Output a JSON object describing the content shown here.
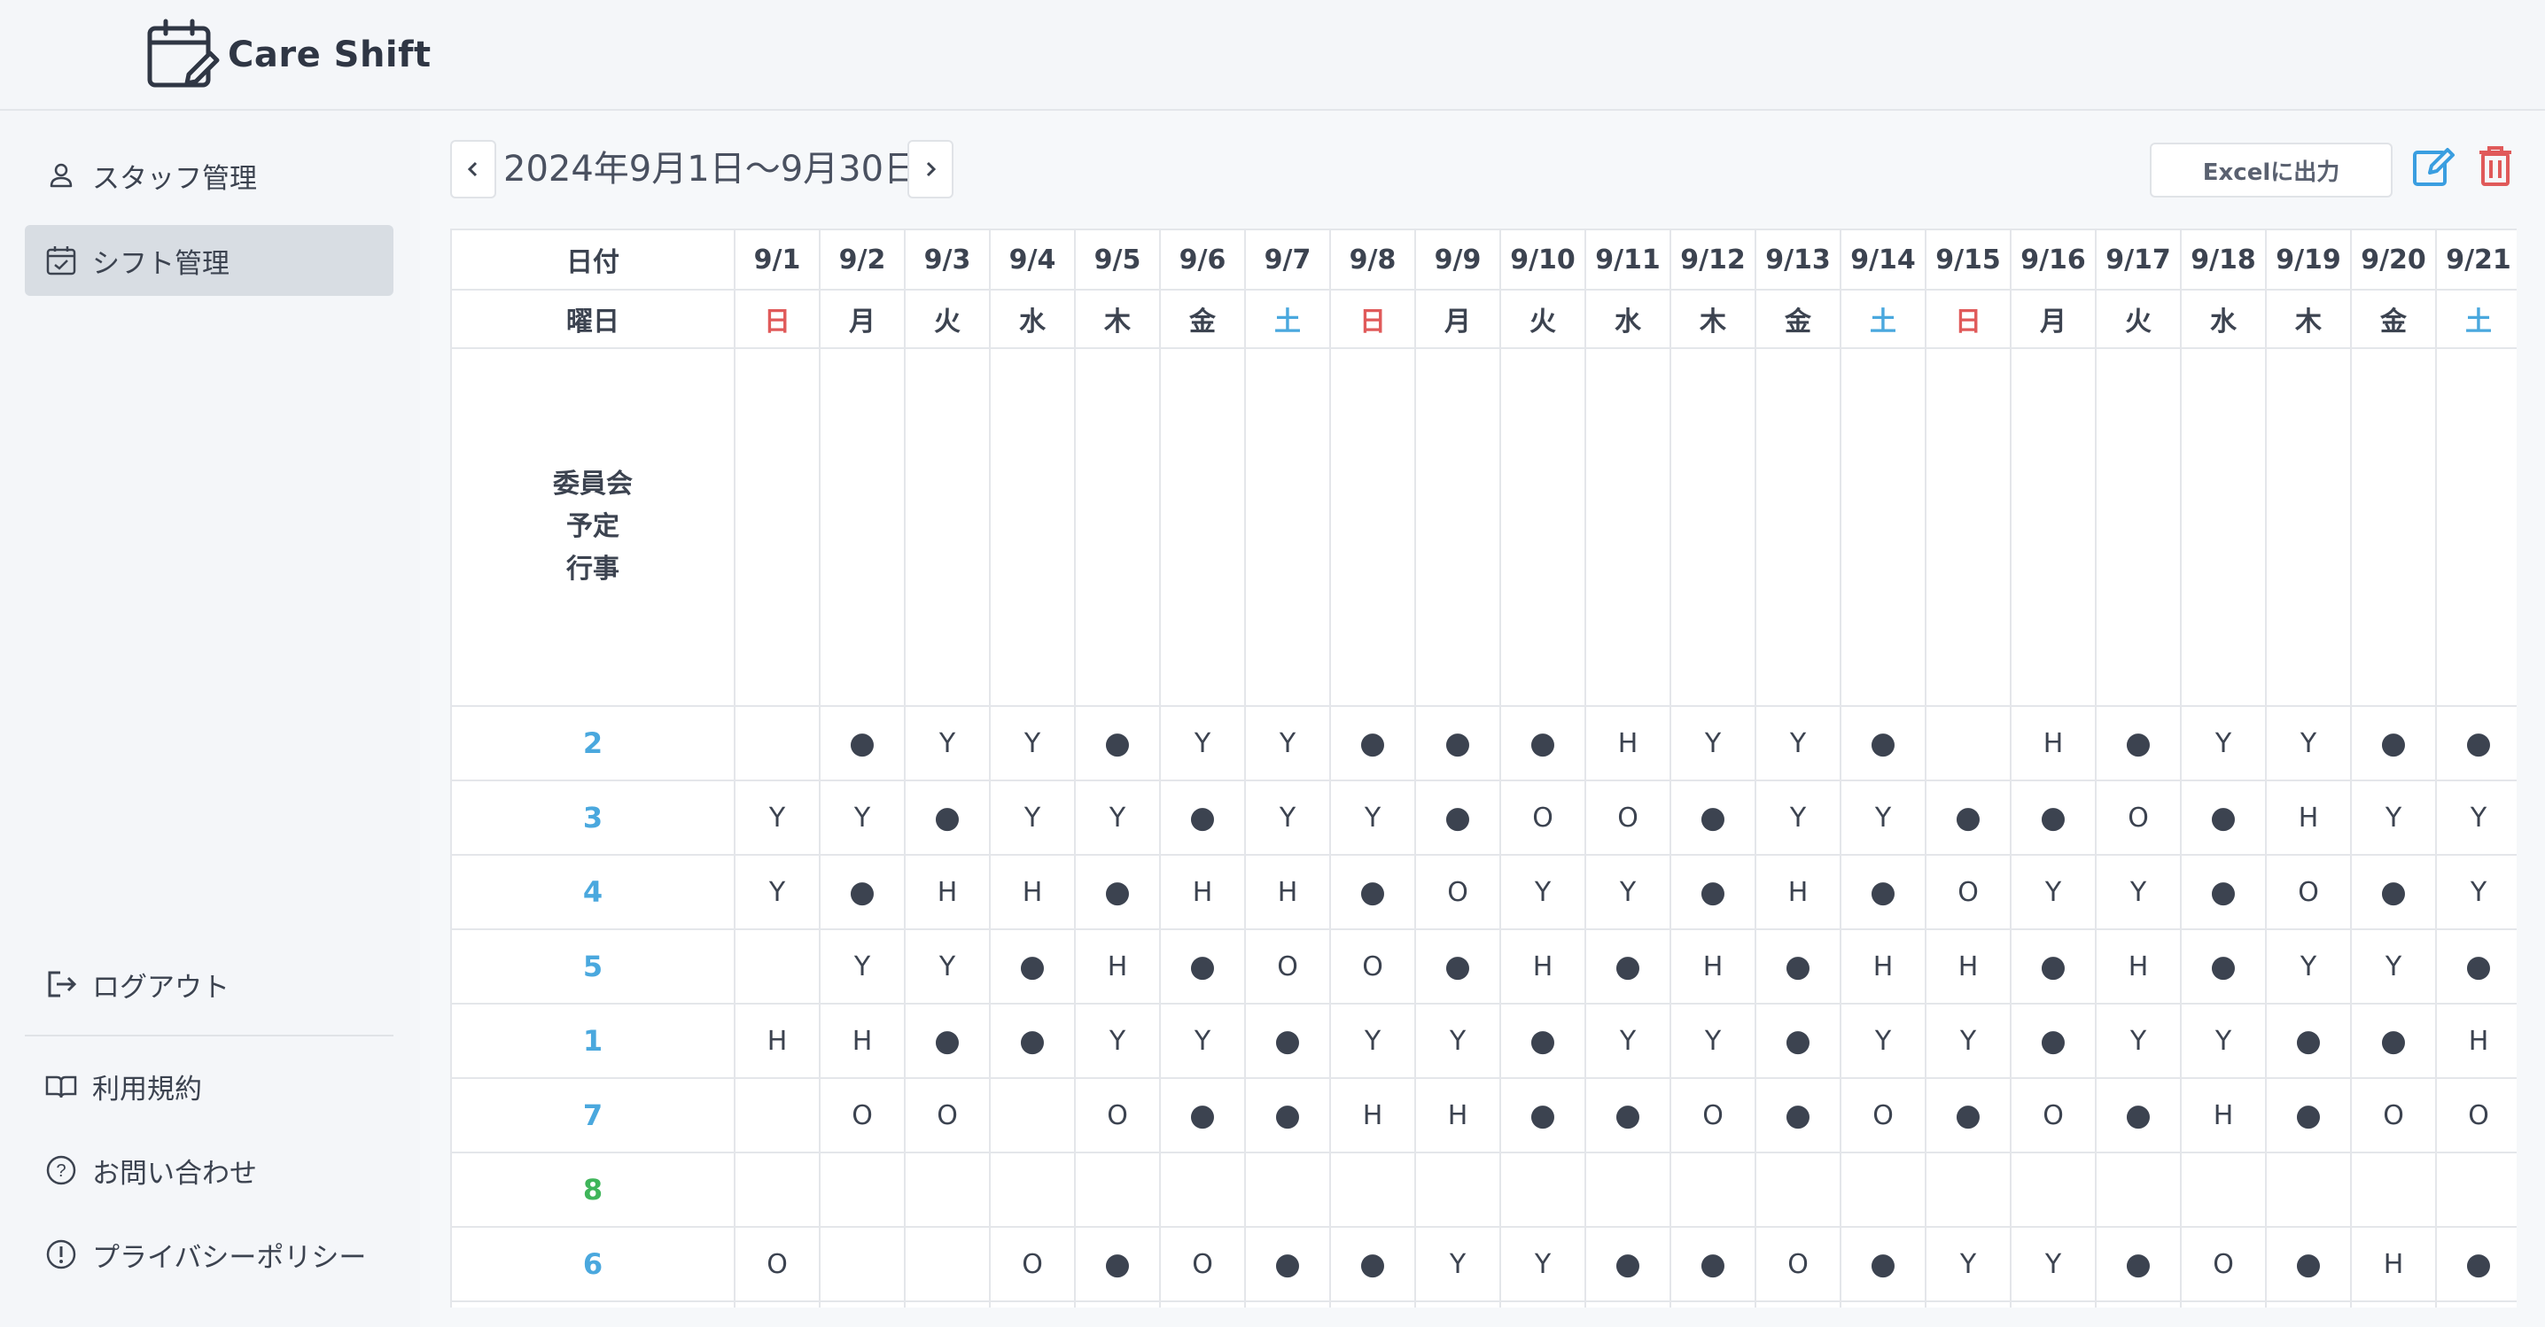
{
  "app": {
    "name": "Care Shift",
    "logo_icon": "calendar-edit-icon"
  },
  "sidebar": {
    "items": [
      {
        "label": "スタッフ管理",
        "icon": "person-icon",
        "active": false
      },
      {
        "label": "シフト管理",
        "icon": "calendar-check-icon",
        "active": true
      }
    ],
    "footer": [
      {
        "label": "ログアウト",
        "icon": "logout-icon"
      },
      {
        "label": "利用規約",
        "icon": "book-icon"
      },
      {
        "label": "お問い合わせ",
        "icon": "question-circle-icon"
      },
      {
        "label": "プライバシーポリシー",
        "icon": "exclamation-circle-icon"
      }
    ]
  },
  "toolbar": {
    "range": "2024年9月1日〜9月30日",
    "excel_label": "Excelに出力",
    "prev_icon": "chevron-left-icon",
    "next_icon": "chevron-right-icon",
    "edit_icon": "edit-icon",
    "delete_icon": "trash-icon",
    "edit_color": "#3a9ee0",
    "delete_color": "#e05a5a"
  },
  "table": {
    "date_header": "日付",
    "weekday_header": "曜日",
    "committee_lines": [
      "委員会",
      "予定",
      "行事"
    ],
    "dates": [
      "9/1",
      "9/2",
      "9/3",
      "9/4",
      "9/5",
      "9/6",
      "9/7",
      "9/8",
      "9/9",
      "9/10",
      "9/11",
      "9/12",
      "9/13",
      "9/14",
      "9/15",
      "9/16",
      "9/17",
      "9/18",
      "9/19",
      "9/20",
      "9/21"
    ],
    "weekdays": [
      "日",
      "月",
      "火",
      "水",
      "木",
      "金",
      "土",
      "日",
      "月",
      "火",
      "水",
      "木",
      "金",
      "土",
      "日",
      "月",
      "火",
      "水",
      "木",
      "金",
      "土"
    ],
    "rows": [
      {
        "staff": "2",
        "color": "blue",
        "cells": [
          "",
          "●",
          "Y",
          "Y",
          "●",
          "Y",
          "Y",
          "●",
          "●",
          "●",
          "H",
          "Y",
          "Y",
          "●",
          "",
          "H",
          "●",
          "Y",
          "Y",
          "●",
          "●"
        ]
      },
      {
        "staff": "3",
        "color": "blue",
        "cells": [
          "Y",
          "Y",
          "●",
          "Y",
          "Y",
          "●",
          "Y",
          "Y",
          "●",
          "O",
          "O",
          "●",
          "Y",
          "Y",
          "●",
          "●",
          "O",
          "●",
          "H",
          "Y",
          "Y"
        ]
      },
      {
        "staff": "4",
        "color": "blue",
        "cells": [
          "Y",
          "●",
          "H",
          "H",
          "●",
          "H",
          "H",
          "●",
          "O",
          "Y",
          "Y",
          "●",
          "H",
          "●",
          "O",
          "Y",
          "Y",
          "●",
          "O",
          "●",
          "Y"
        ]
      },
      {
        "staff": "5",
        "color": "blue",
        "cells": [
          "",
          "Y",
          "Y",
          "●",
          "H",
          "●",
          "O",
          "O",
          "●",
          "H",
          "●",
          "H",
          "●",
          "H",
          "H",
          "●",
          "H",
          "●",
          "Y",
          "Y",
          "●"
        ]
      },
      {
        "staff": "1",
        "color": "blue",
        "cells": [
          "H",
          "H",
          "●",
          "●",
          "Y",
          "Y",
          "●",
          "Y",
          "Y",
          "●",
          "Y",
          "Y",
          "●",
          "Y",
          "Y",
          "●",
          "Y",
          "Y",
          "●",
          "●",
          "H"
        ]
      },
      {
        "staff": "7",
        "color": "blue",
        "cells": [
          "",
          "O",
          "O",
          "",
          "O",
          "●",
          "●",
          "H",
          "H",
          "●",
          "●",
          "O",
          "●",
          "O",
          "●",
          "O",
          "●",
          "H",
          "●",
          "O",
          "O"
        ]
      },
      {
        "staff": "8",
        "color": "green",
        "cells": [
          "",
          "",
          "",
          "",
          "",
          "",
          "",
          "",
          "",
          "",
          "",
          "",
          "",
          "",
          "",
          "",
          "",
          "",
          "",
          "",
          ""
        ]
      },
      {
        "staff": "6",
        "color": "blue",
        "cells": [
          "O",
          "",
          "",
          "O",
          "●",
          "O",
          "●",
          "●",
          "Y",
          "Y",
          "●",
          "●",
          "O",
          "●",
          "Y",
          "Y",
          "●",
          "O",
          "●",
          "H",
          "●"
        ]
      }
    ]
  }
}
